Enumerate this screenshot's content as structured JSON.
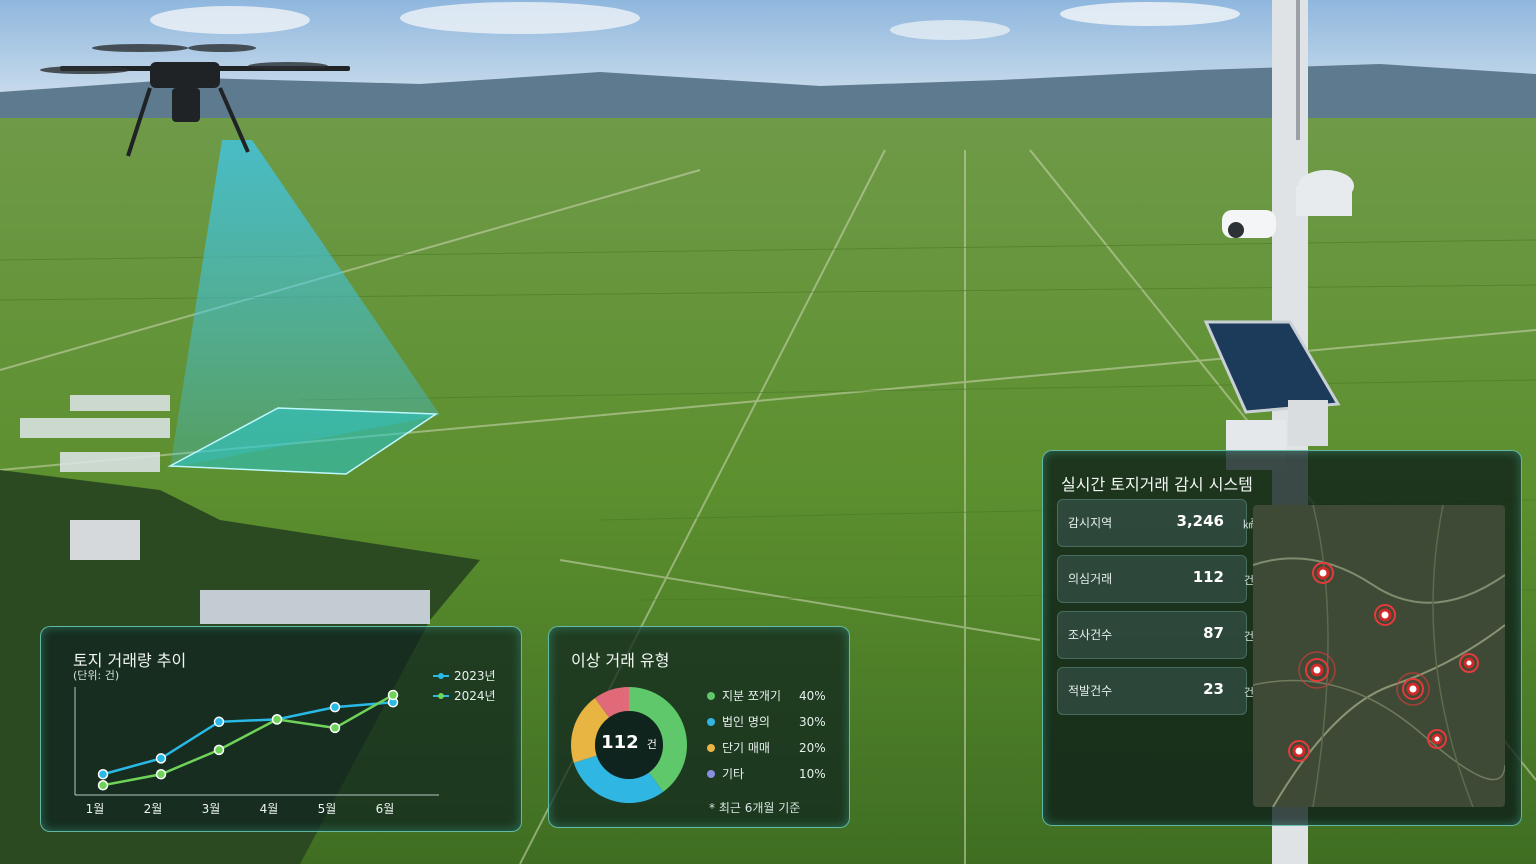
{
  "trend_panel": {
    "title": "토지 거래량 추이",
    "unit": "(단위: 건)",
    "legend": [
      "2023년",
      "2024년"
    ]
  },
  "type_panel": {
    "title": "이상 거래 유형",
    "center_value": "112",
    "center_unit": "건",
    "items": [
      {
        "label": "지분 쪼개기",
        "pct": "40%",
        "color": "#5ec86a"
      },
      {
        "label": "법인 명의",
        "pct": "30%",
        "color": "#2fb6e2"
      },
      {
        "label": "단기 매매",
        "pct": "20%",
        "color": "#e8b442"
      },
      {
        "label": "기타",
        "pct": "10%",
        "color": "#8a8ee0"
      }
    ],
    "footnote": "* 최근 6개월 기준"
  },
  "monitor_panel": {
    "title": "실시간 토지거래 감시 시스템",
    "stats": [
      {
        "label": "감시지역",
        "value": "3,246",
        "unit": "㎢"
      },
      {
        "label": "의심거래",
        "value": "112",
        "unit": "건"
      },
      {
        "label": "조사건수",
        "value": "87",
        "unit": "건"
      },
      {
        "label": "적발건수",
        "value": "23",
        "unit": "건"
      }
    ]
  },
  "chart_data": [
    {
      "type": "line",
      "title": "토지 거래량 추이",
      "categories": [
        "1월",
        "2월",
        "3월",
        "4월",
        "5월",
        "6월"
      ],
      "series": [
        {
          "name": "2023년",
          "values": [
            17,
            30,
            60,
            62,
            72,
            76
          ],
          "color": "#2ab8e6"
        },
        {
          "name": "2024년",
          "values": [
            8,
            17,
            37,
            62,
            55,
            82
          ],
          "color": "#6fd35a"
        }
      ],
      "ylim": [
        0,
        100
      ]
    },
    {
      "type": "pie",
      "title": "이상 거래 유형",
      "labels": [
        "지분 쪼개기",
        "법인 명의",
        "단기 매매",
        "기타"
      ],
      "values": [
        40,
        30,
        20,
        10
      ],
      "colors": [
        "#5ec86a",
        "#2fb6e2",
        "#e8b442",
        "#e06a78"
      ]
    }
  ]
}
